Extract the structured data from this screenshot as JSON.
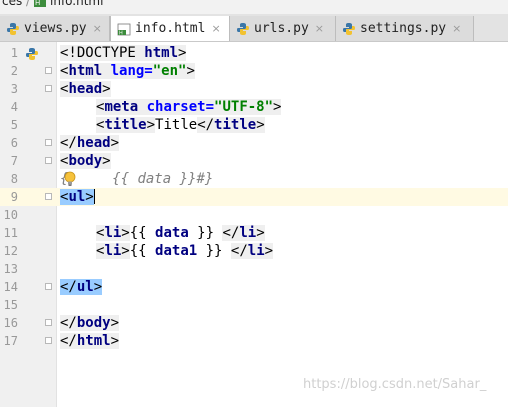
{
  "breadcrumb": {
    "items": [
      "ces",
      "info.html"
    ],
    "separator": "/"
  },
  "tabs": [
    {
      "label": "views.py",
      "icon": "python-icon",
      "active": false
    },
    {
      "label": "info.html",
      "icon": "html-file-icon",
      "active": true
    },
    {
      "label": "urls.py",
      "icon": "python-icon",
      "active": false
    },
    {
      "label": "settings.py",
      "icon": "python-icon",
      "active": false
    }
  ],
  "tab_close_glyph": "×",
  "editor": {
    "line_numbers": [
      "1",
      "2",
      "3",
      "4",
      "5",
      "6",
      "7",
      "8",
      "9",
      "10",
      "11",
      "12",
      "13",
      "14",
      "15",
      "16",
      "17"
    ],
    "current_line": "9",
    "lines": {
      "l1": {
        "p1": "<!DOCTYPE ",
        "p2": "html",
        "p3": ">"
      },
      "l2": {
        "p1": "<",
        "p2": "html ",
        "p3": "lang=",
        "p4": "\"en\"",
        "p5": ">"
      },
      "l3": {
        "p1": "<",
        "p2": "head",
        "p3": ">"
      },
      "l4": {
        "p1": "<",
        "p2": "meta ",
        "p3": "charset=",
        "p4": "\"UTF-8\"",
        "p5": ">"
      },
      "l5": {
        "p1": "<",
        "p2": "title",
        "p3": ">",
        "p4": "Title",
        "p5": "</",
        "p6": "title",
        "p7": ">"
      },
      "l6": {
        "p1": "</",
        "p2": "head",
        "p3": ">"
      },
      "l7": {
        "p1": "<",
        "p2": "body",
        "p3": ">"
      },
      "l8": {
        "p1": "{",
        "p2": "    {{ data }}#}"
      },
      "l9": {
        "p1": "<",
        "p2": "ul",
        "p3": ">"
      },
      "l11": {
        "p1": "<",
        "p2": "li",
        "p3": ">",
        "p4": "{{ ",
        "p5": "data",
        "p6": " }} ",
        "p7": "</",
        "p8": "li",
        "p9": ">"
      },
      "l12": {
        "p1": "<",
        "p2": "li",
        "p3": ">",
        "p4": "{{ ",
        "p5": "data1",
        "p6": " }} ",
        "p7": "</",
        "p8": "li",
        "p9": ">"
      },
      "l14": {
        "p1": "</",
        "p2": "ul",
        "p3": ">"
      },
      "l16": {
        "p1": "</",
        "p2": "body",
        "p3": ">"
      },
      "l17": {
        "p1": "</",
        "p2": "html",
        "p3": ">"
      }
    }
  },
  "watermark": "https://blog.csdn.net/Sahar_",
  "colors": {
    "tag_keyword": "#000080",
    "attribute": "#0000ff",
    "string": "#008000",
    "comment": "#808080",
    "current_line": "#fffae3",
    "tag_highlight": "#99ccff"
  }
}
